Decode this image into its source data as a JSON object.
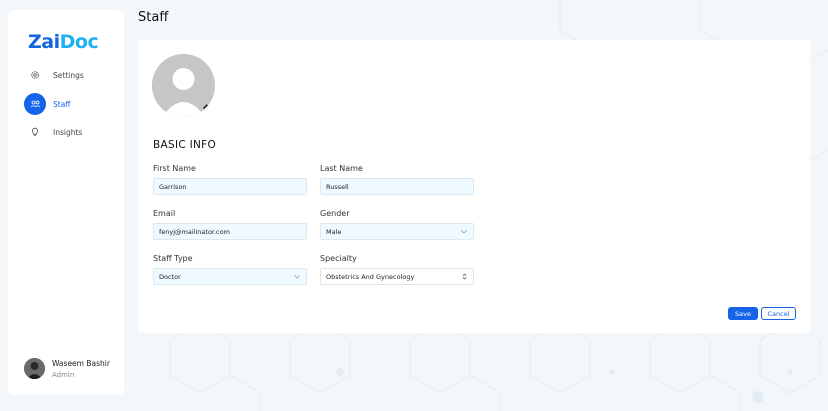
{
  "app": {
    "logo_part1": "Zai",
    "logo_part2": "Doc"
  },
  "sidebar": {
    "items": [
      {
        "label": "Settings",
        "icon": "gear-icon",
        "active": false
      },
      {
        "label": "Staff",
        "icon": "users-icon",
        "active": true
      },
      {
        "label": "Insights",
        "icon": "bulb-icon",
        "active": false
      }
    ],
    "user": {
      "name": "Waseem Bashir",
      "role": "Admin"
    }
  },
  "header": {
    "title": "Staff"
  },
  "form": {
    "section_title": "BASIC INFO",
    "first_name": {
      "label": "First Name",
      "value": "Garrison"
    },
    "last_name": {
      "label": "Last Name",
      "value": "Russell"
    },
    "email": {
      "label": "Email",
      "value": "fenyj@mailinator.com"
    },
    "gender": {
      "label": "Gender",
      "value": "Male"
    },
    "staff_type": {
      "label": "Staff Type",
      "value": "Doctor"
    },
    "specialty": {
      "label": "Specialty",
      "value": "Obstetrics And Gynecology"
    },
    "save_label": "Save",
    "cancel_label": "Cancel"
  },
  "colors": {
    "primary": "#1463e8",
    "field_bg": "#eefaff",
    "accent": "#20b0f0"
  }
}
